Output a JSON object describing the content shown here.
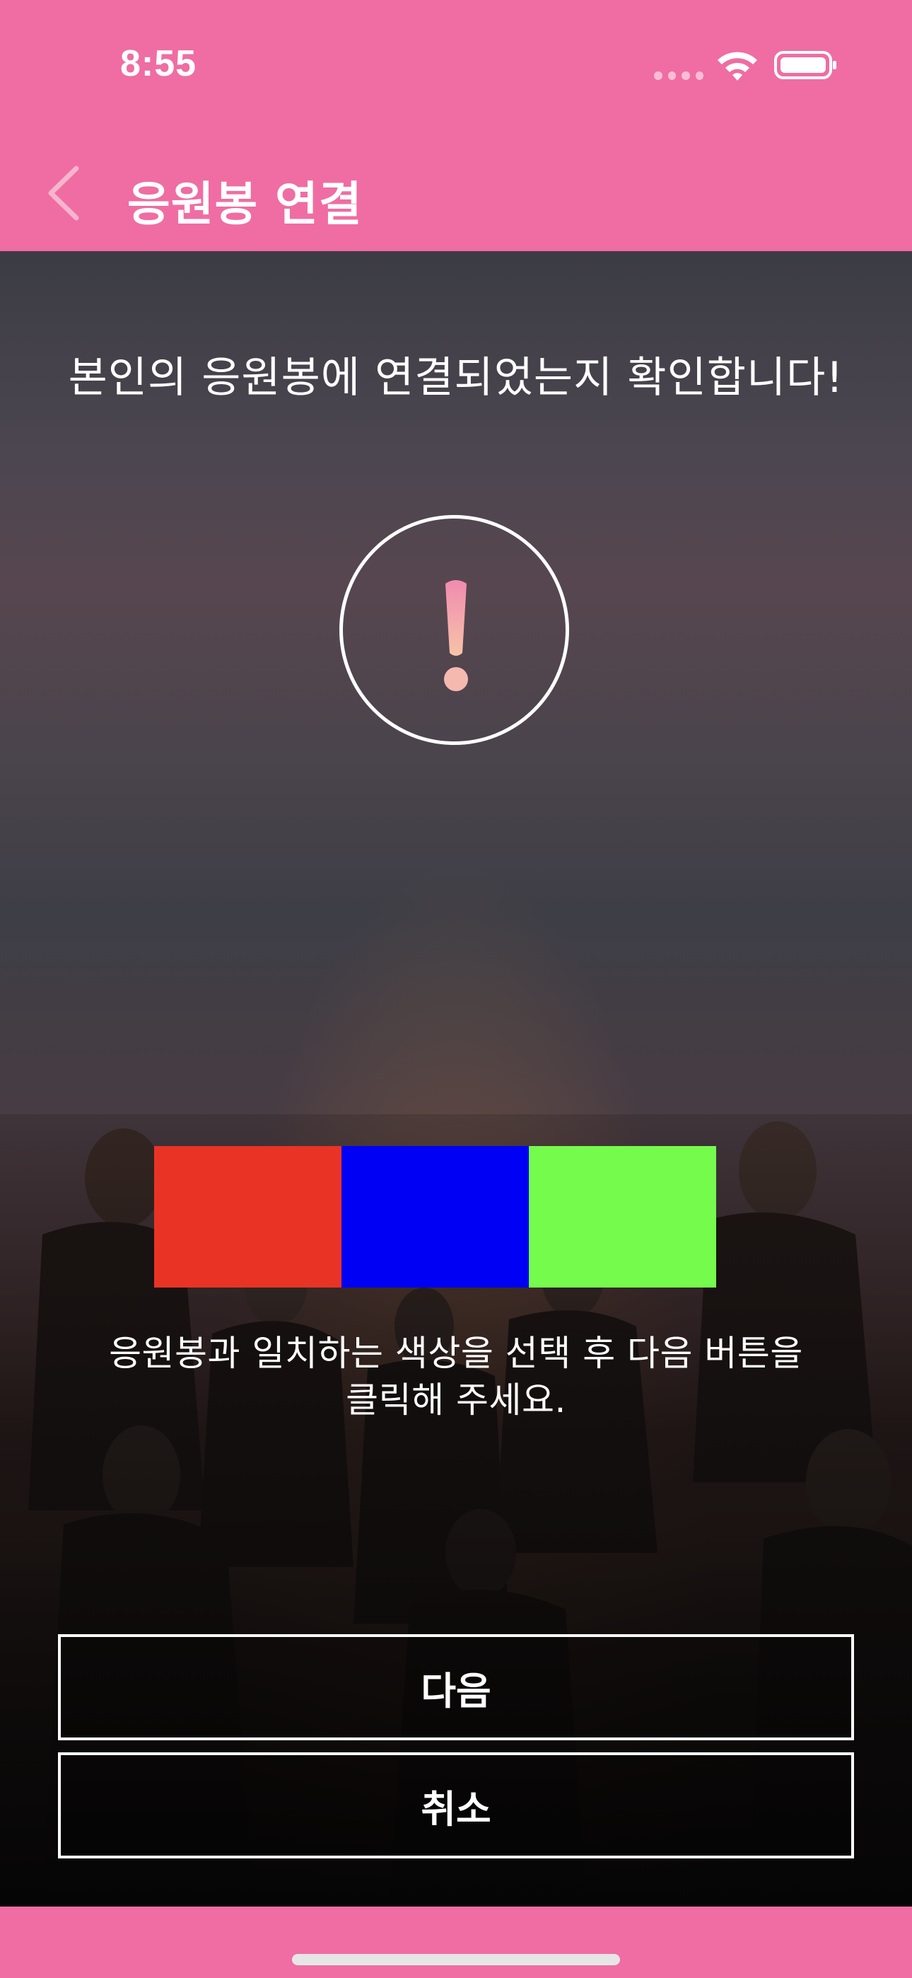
{
  "status_bar": {
    "time": "8:55",
    "wifi_icon": "wifi-icon",
    "battery_icon": "battery-icon"
  },
  "header": {
    "title": "응원봉 연결",
    "back_icon": "chevron-left-icon",
    "background_color": "#ef6da3"
  },
  "main": {
    "heading": "본인의 응원봉에 연결되었는지 확인합니다!",
    "alert_icon": "exclamation-icon",
    "color_options": [
      {
        "name": "red",
        "color": "#e93325"
      },
      {
        "name": "blue",
        "color": "#0000f5"
      },
      {
        "name": "green",
        "color": "#75fb4c"
      }
    ],
    "instruction_line1": "응원봉과 일치하는 색상을 선택 후 다음 버튼을",
    "instruction_line2": "클릭해 주세요."
  },
  "buttons": {
    "next_label": "다음",
    "cancel_label": "취소"
  }
}
